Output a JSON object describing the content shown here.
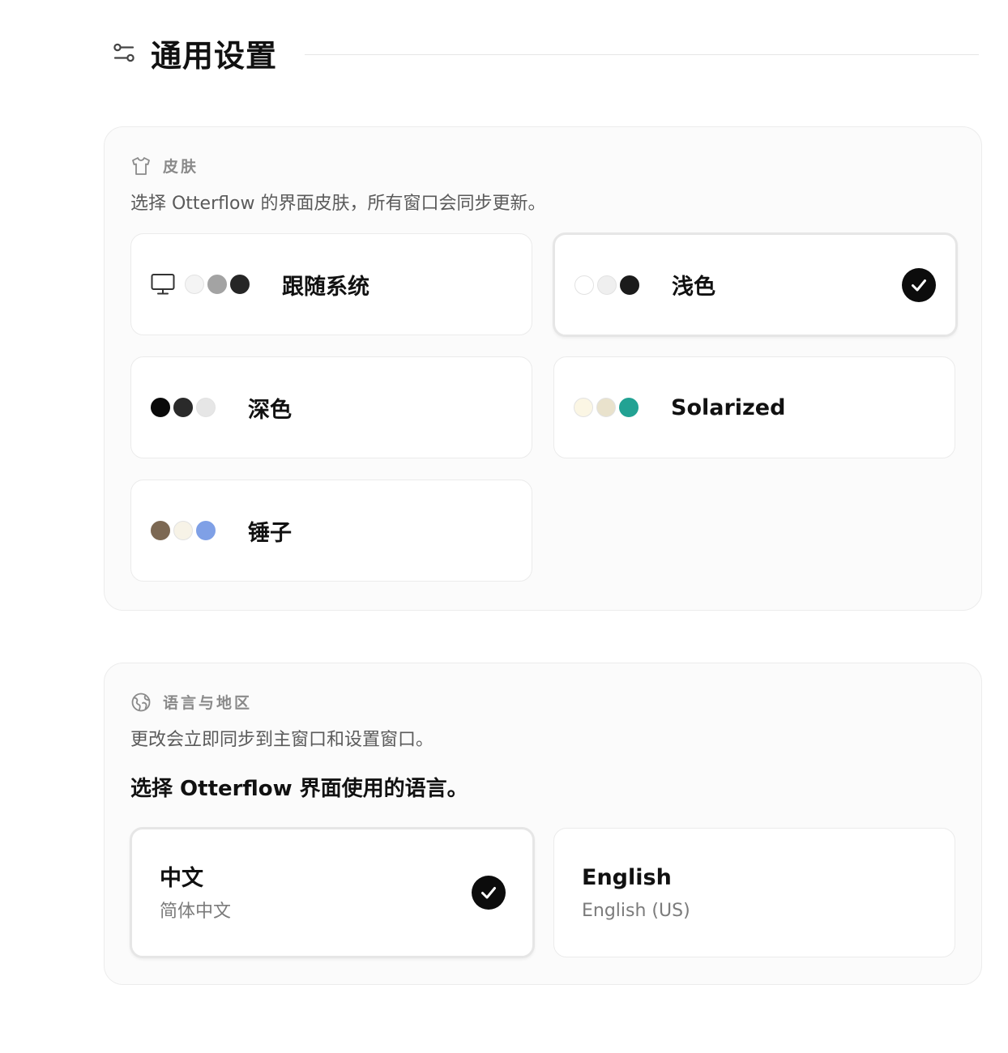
{
  "header": {
    "title": "通用设置",
    "icon": "sliders-icon"
  },
  "skin": {
    "label": "皮肤",
    "icon": "shirt-icon",
    "description": "选择 Otterflow 的界面皮肤，所有窗口会同步更新。",
    "options": [
      {
        "label": "跟随系统",
        "has_monitor_icon": true,
        "selected": false,
        "swatches": [
          "#f4f4f4",
          "#a3a3a3",
          "#262626"
        ]
      },
      {
        "label": "浅色",
        "has_monitor_icon": false,
        "selected": true,
        "swatches": [
          "#ffffff",
          "#efefef",
          "#1b1b1b"
        ]
      },
      {
        "label": "深色",
        "has_monitor_icon": false,
        "selected": false,
        "swatches": [
          "#0a0a0a",
          "#2a2a2a",
          "#e6e6e6"
        ]
      },
      {
        "label": "Solarized",
        "has_monitor_icon": false,
        "selected": false,
        "swatches": [
          "#fbf6e4",
          "#e9e2cc",
          "#22a293"
        ]
      },
      {
        "label": "锤子",
        "has_monitor_icon": false,
        "selected": false,
        "swatches": [
          "#7c6853",
          "#f7f3e7",
          "#7fa0e6"
        ]
      }
    ]
  },
  "language": {
    "label": "语言与地区",
    "icon": "globe-icon",
    "description": "更改会立即同步到主窗口和设置窗口。",
    "question": "选择 Otterflow 界面使用的语言。",
    "options": [
      {
        "name": "中文",
        "subtitle": "简体中文",
        "selected": true
      },
      {
        "name": "English",
        "subtitle": "English (US)",
        "selected": false
      }
    ]
  },
  "colors": {
    "check_bg": "#0c0c0c",
    "panel_bg": "#fbfbfb",
    "panel_border": "#ececec",
    "muted_text": "#8a8a8a"
  }
}
